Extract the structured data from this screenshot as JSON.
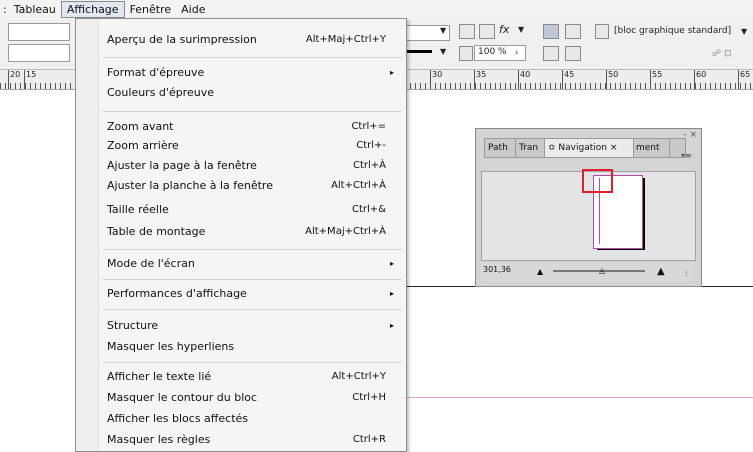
{
  "menubar": {
    "items": [
      {
        "label": ":"
      },
      {
        "label": "Tableau"
      },
      {
        "label": "Affichage"
      },
      {
        "label": "Fenêtre"
      },
      {
        "label": "Aide"
      }
    ]
  },
  "toolbar": {
    "zoom_value": "100 %",
    "fx_label": "fx",
    "frame_style": "[bloc graphique standard]"
  },
  "ruler": {
    "left_labels": [
      "20",
      "15"
    ],
    "right_labels": [
      "30",
      "35",
      "40",
      "45",
      "50",
      "55",
      "60",
      "65"
    ]
  },
  "menu": {
    "items": [
      {
        "label": "Aperçu de la surimpression",
        "shortcut": "Alt+Maj+Ctrl+Y"
      },
      {
        "label": "Format d'épreuve",
        "submenu": true
      },
      {
        "label": "Couleurs d'épreuve"
      },
      {
        "label": "Zoom avant",
        "shortcut": "Ctrl+="
      },
      {
        "label": "Zoom arrière",
        "shortcut": "Ctrl+-"
      },
      {
        "label": "Ajuster la page à la fenêtre",
        "shortcut": "Ctrl+À"
      },
      {
        "label": "Ajuster la planche à la fenêtre",
        "shortcut": "Alt+Ctrl+À"
      },
      {
        "label": "Taille réelle",
        "shortcut": "Ctrl+&"
      },
      {
        "label": "Table de montage",
        "shortcut": "Alt+Maj+Ctrl+À"
      },
      {
        "label": "Mode de l'écran",
        "submenu": true
      },
      {
        "label": "Performances d'affichage",
        "submenu": true
      },
      {
        "label": "Structure",
        "submenu": true
      },
      {
        "label": "Masquer les hyperliens"
      },
      {
        "label": "Afficher le texte lié",
        "shortcut": "Alt+Ctrl+Y"
      },
      {
        "label": "Masquer le contour du bloc",
        "shortcut": "Ctrl+H"
      },
      {
        "label": "Afficher les blocs affectés"
      },
      {
        "label": "Masquer les règles",
        "shortcut": "Ctrl+R"
      }
    ],
    "submenu_arrow": "▸"
  },
  "panel": {
    "tabs": [
      "Path",
      "Tran",
      "Navigation",
      "ment"
    ],
    "active_tab_prefix": "≎ ",
    "close_mark": "×",
    "collapse_mark": "- ×",
    "menu_mark": "▾≡",
    "zoom_value": "301,36"
  },
  "colors": {
    "menu_border": "#8f8f8f",
    "view_box": "#e0202a",
    "page_outline": "#b04cb0",
    "guide_line": "#e6a0d8"
  }
}
